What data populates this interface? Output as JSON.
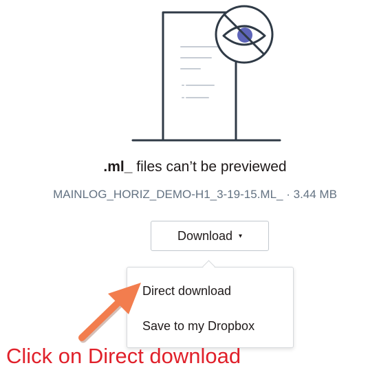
{
  "preview": {
    "extension": ".ml_",
    "message_suffix": " files can’t be previewed",
    "file_name": "MAINLOG_HORIZ_DEMO-H1_3-19-15.ML_",
    "separator": " · ",
    "file_size": "3.44 MB",
    "illustration_icon": "hidden-eye-document-icon"
  },
  "download": {
    "label": "Download",
    "caret": "▾"
  },
  "menu": {
    "items": [
      {
        "label": "Direct download"
      },
      {
        "label": "Save to my Dropbox"
      }
    ]
  },
  "annotation": {
    "text": "Click on Direct download",
    "color": "#e0202a",
    "arrow_color": "#f27d4e"
  }
}
